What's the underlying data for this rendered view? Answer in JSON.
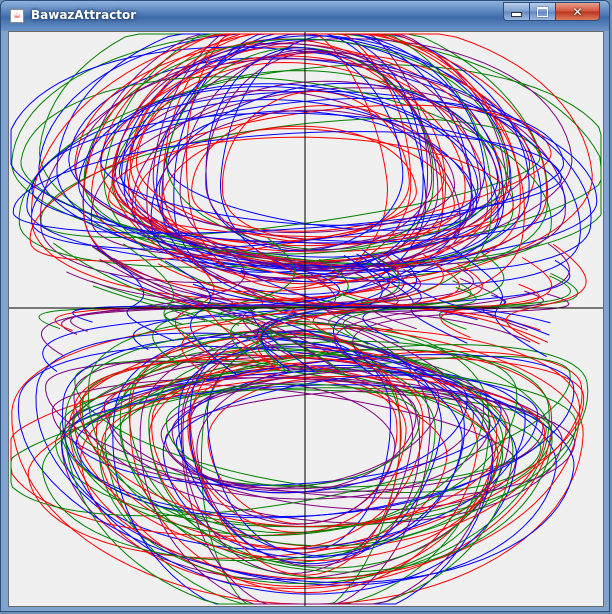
{
  "window": {
    "title": "BawazAttractor",
    "icon": "java-cup-icon",
    "controls": [
      "minimize-icon",
      "maximize-icon",
      "close-icon"
    ]
  },
  "plot": {
    "background_color": "#f0f0f0",
    "axis_color": "#000000",
    "trajectory_colors": [
      "#0000ff",
      "#ff0000",
      "#008000",
      "#800080"
    ]
  }
}
